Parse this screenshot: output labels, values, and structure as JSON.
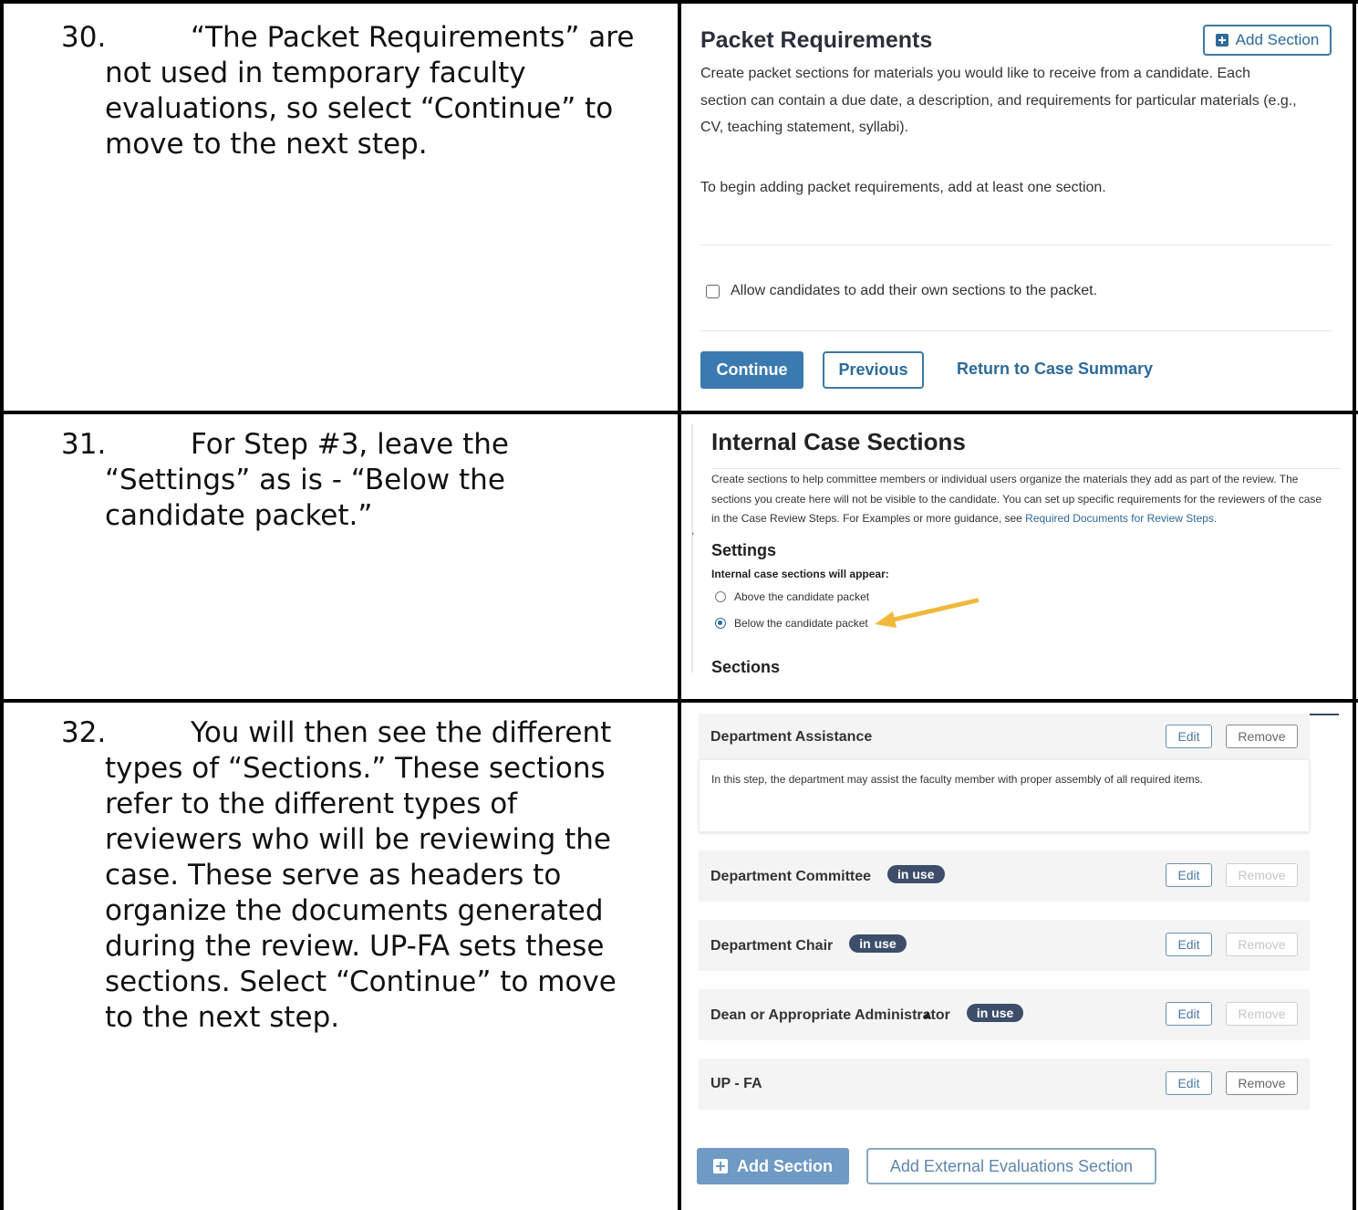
{
  "rows": [
    {
      "number": "30.",
      "first_line": "“The Packet Requirements” are",
      "rest_lines": [
        "not used in temporary faculty",
        "evaluations, so select “Continue” to",
        "move to the next step."
      ]
    },
    {
      "number": "31.",
      "first_line": "For Step #3, leave the",
      "rest_lines": [
        "“Settings” as is - “Below the",
        "candidate packet.”"
      ]
    },
    {
      "number": "32.",
      "first_line": "You will then see the different",
      "rest_lines": [
        "types of “Sections.” These sections",
        "refer to the different types of",
        "reviewers who will be reviewing the",
        "case. These serve as headers to",
        "organize the documents generated",
        "during the review. UP-FA sets these",
        "sections. Select “Continue” to move",
        "to the next step."
      ]
    }
  ],
  "packet": {
    "title": "Packet Requirements",
    "add_section": "Add Section",
    "desc_lines": [
      "Create packet sections for materials you would like to receive from a candidate. Each",
      "section can contain a due date, a description, and requirements for particular materials (e.g.,",
      "CV, teaching statement, syllabi)."
    ],
    "begin": "To begin adding packet requirements, add at least one section.",
    "checkbox_label": "Allow candidates to add their own sections to the packet.",
    "continue": "Continue",
    "previous": "Previous",
    "return": "Return to Case Summary"
  },
  "internal": {
    "title": "Internal Case Sections",
    "desc_line1": "Create sections to help committee members or individual users organize the materials they add as part of the review. The",
    "desc_line2": "sections you create here will not be visible to the candidate. You can set up specific requirements for the reviewers of the case",
    "desc_line3_prefix": "in the Case Review Steps. For Examples or more guidance, see ",
    "desc_link": "Required Documents for Review Steps.",
    "tick": ",",
    "settings": "Settings",
    "appear_label": "Internal case sections will appear:",
    "option_above": "Above the candidate packet",
    "option_below": "Below the candidate packet",
    "selected": "Below the candidate packet",
    "sections": "Sections",
    "arrow_color": "#f0b93c"
  },
  "review_sections": {
    "items": [
      {
        "name": "Department Assistance",
        "badge": "",
        "edit": "Edit",
        "remove": "Remove"
      },
      {
        "name": "Department Committee",
        "badge": "in use",
        "edit": "Edit",
        "remove": "Remove"
      },
      {
        "name": "Department Chair",
        "badge": "in use",
        "edit": "Edit",
        "remove": "Remove"
      },
      {
        "name": "Dean or Appropriate Administrator",
        "badge": "in use",
        "edit": "Edit",
        "remove": "Remove"
      },
      {
        "name": "UP - FA",
        "badge": "",
        "edit": "Edit",
        "remove": "Remove"
      }
    ],
    "assistance_desc": "In this step, the department may assist the faculty member with proper assembly of all required items.",
    "add_section": "Add Section",
    "add_external": "Add External Evaluations Section"
  }
}
